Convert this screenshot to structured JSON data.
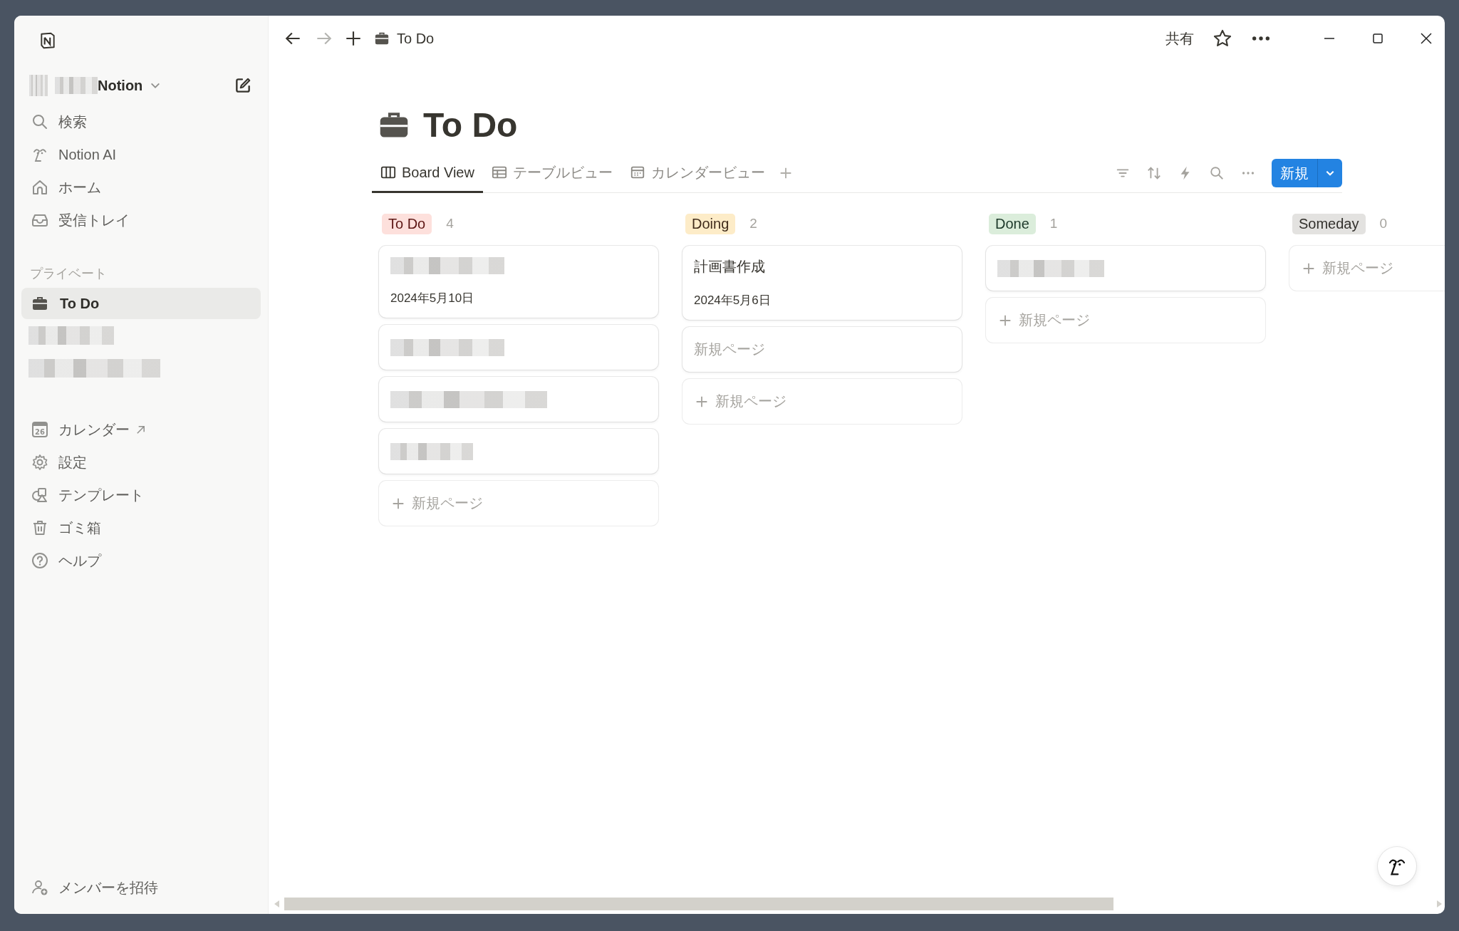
{
  "sidebar": {
    "workspace": {
      "name": "Notion"
    },
    "nav": [
      {
        "label": "検索"
      },
      {
        "label": "Notion AI"
      },
      {
        "label": "ホーム"
      },
      {
        "label": "受信トレイ"
      }
    ],
    "section": "プライベート",
    "pages": [
      {
        "kind": "page",
        "label": "To Do",
        "selected": true
      },
      {
        "kind": "redacted",
        "selected": false
      },
      {
        "kind": "redacted",
        "selected": false
      }
    ],
    "tools": [
      {
        "label": "カレンダー",
        "badge": "26",
        "external": true
      },
      {
        "label": "設定",
        "external": false
      },
      {
        "label": "テンプレート",
        "external": false
      },
      {
        "label": "ゴミ箱",
        "external": false
      },
      {
        "label": "ヘルプ",
        "external": false
      }
    ],
    "invite": "メンバーを招待"
  },
  "topbar": {
    "breadcrumb": "To Do",
    "share": "共有"
  },
  "page": {
    "title": "To Do",
    "views": [
      {
        "label": "Board View",
        "selected": true
      },
      {
        "label": "テーブルビュー",
        "selected": false
      },
      {
        "label": "カレンダービュー",
        "selected": false
      }
    ],
    "new_button": "新規"
  },
  "board": {
    "columns": [
      {
        "label": "To Do",
        "color": "#fde0dc",
        "count": "4",
        "add_label": "新規ページ",
        "cards": [
          {
            "kind": "redacted",
            "date": "2024年5月10日"
          },
          {
            "kind": "redacted"
          },
          {
            "kind": "redacted"
          },
          {
            "kind": "redacted"
          }
        ]
      },
      {
        "label": "Doing",
        "color": "#fdecc8",
        "count": "2",
        "add_label": "新規ページ",
        "cards": [
          {
            "kind": "titled",
            "title": "計画書作成",
            "date": "2024年5月6日"
          },
          {
            "kind": "untitled",
            "title": "新規ページ"
          }
        ]
      },
      {
        "label": "Done",
        "color": "#dbeddb",
        "count": "1",
        "add_label": "新規ページ",
        "cards": [
          {
            "kind": "redacted"
          }
        ]
      },
      {
        "label": "Someday",
        "color": "#e3e2e0",
        "count": "0",
        "add_label": "新規ページ"
      }
    ]
  }
}
